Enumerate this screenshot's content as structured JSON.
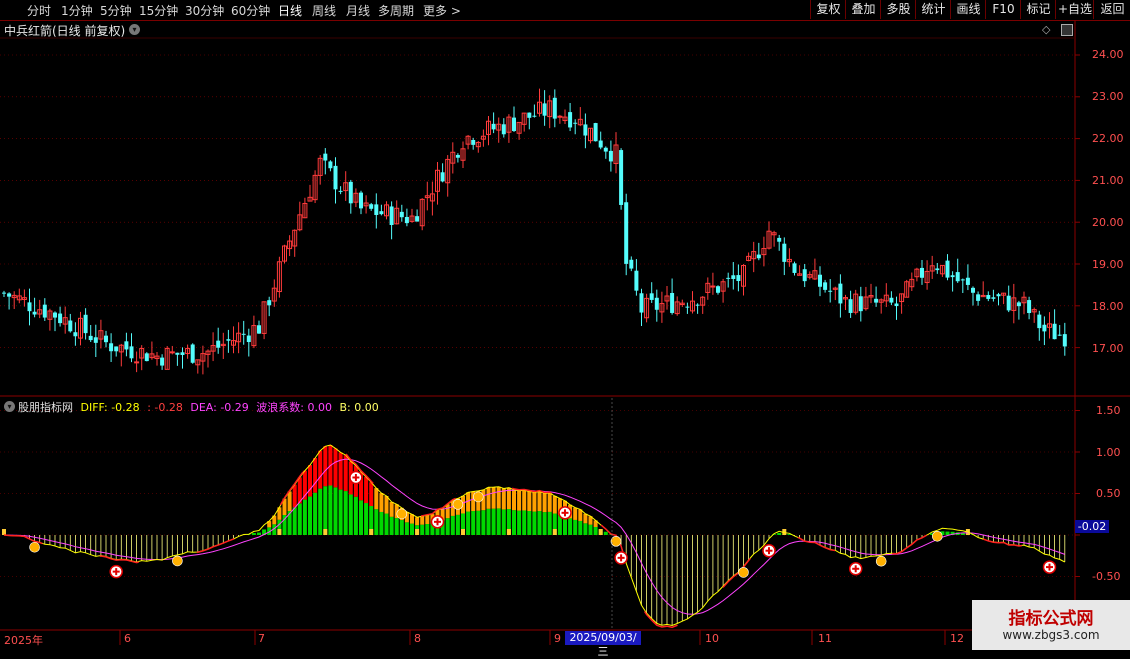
{
  "toolbar": {
    "timeframes": [
      "分时",
      "1分钟",
      "5分钟",
      "15分钟",
      "30分钟",
      "60分钟",
      "日线",
      "周线",
      "月线",
      "多周期",
      "更多 >"
    ],
    "active": "日线",
    "right_buttons": [
      "复权",
      "叠加",
      "多股",
      "统计",
      "画线",
      "F10",
      "标记",
      "+自选",
      "返回"
    ]
  },
  "main": {
    "title": "中兵红箭(日线 前复权)",
    "price_axis": [
      "24.00",
      "23.00",
      "22.00",
      "21.00",
      "20.00",
      "19.00",
      "18.00",
      "17.00"
    ]
  },
  "indicator": {
    "name": "股朋指标网",
    "diff_label": "DIFF: -0.28",
    "diff2_label": ": -0.28",
    "dea_label": "DEA: -0.29",
    "wave_label": "波浪系数: 0.00",
    "b_label": "B: 0.00",
    "axis": [
      "1.50",
      "1.00",
      "0.50",
      "-0.50"
    ],
    "current_value": "-0.02"
  },
  "date_axis": {
    "labels": [
      "2025年",
      "6",
      "7",
      "8",
      "9",
      "10",
      "11",
      "12"
    ],
    "highlight": "2025/09/03/三"
  },
  "watermark": {
    "title": "指标公式网",
    "url": "www.zbgs3.com"
  },
  "colors": {
    "up": "#ff3b3b",
    "down": "#54fcfc",
    "grid": "#8b0000",
    "diff": "#ffff00",
    "dea": "#ff44ff",
    "accent_red": "#ff0000"
  },
  "chart_data": {
    "type": "candlestick",
    "y_range": [
      16.5,
      24.5
    ],
    "dates_approx": "2025-05 to 2025-12",
    "close_path_knots": [
      [
        0,
        18.3
      ],
      [
        10,
        17.8
      ],
      [
        20,
        17.1
      ],
      [
        30,
        16.8
      ],
      [
        40,
        16.9
      ],
      [
        50,
        17.5
      ],
      [
        57,
        19.9
      ],
      [
        62,
        21.4
      ],
      [
        70,
        20.3
      ],
      [
        80,
        20.1
      ],
      [
        90,
        22.0
      ],
      [
        100,
        22.4
      ],
      [
        107,
        22.7
      ],
      [
        112,
        22.5
      ],
      [
        120,
        21.6
      ],
      [
        122,
        19.0
      ],
      [
        125,
        17.9
      ],
      [
        135,
        18.2
      ],
      [
        145,
        18.7
      ],
      [
        150,
        19.8
      ],
      [
        155,
        18.9
      ],
      [
        165,
        18.1
      ],
      [
        175,
        18.0
      ],
      [
        182,
        19.1
      ],
      [
        190,
        18.3
      ],
      [
        200,
        18.0
      ],
      [
        204,
        17.4
      ],
      [
        208,
        17.3
      ]
    ]
  }
}
